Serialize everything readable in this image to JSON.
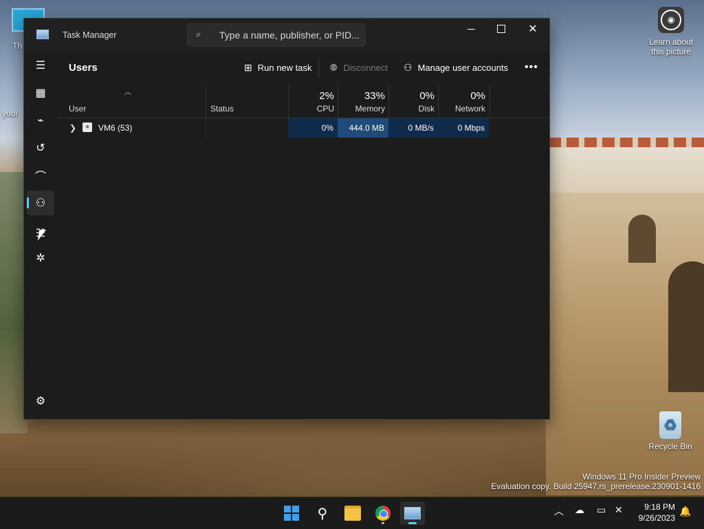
{
  "desktop": {
    "icons": [
      {
        "label": "Learn about this picture"
      },
      {
        "label": "Recycle Bin"
      }
    ],
    "left_fragments": [
      "Th",
      "your"
    ],
    "watermark": {
      "line1": "Windows 11 Pro Insider Preview",
      "line2": "Evaluation copy. Build 25947.rs_prerelease.230901-1416"
    }
  },
  "window": {
    "title": "Task Manager",
    "search_placeholder": "Type a name, publisher, or PID..."
  },
  "nav": {
    "items": [
      {
        "icon": "hamburger-menu-icon"
      },
      {
        "icon": "processes-icon"
      },
      {
        "icon": "performance-icon"
      },
      {
        "icon": "app-history-icon"
      },
      {
        "icon": "startup-apps-icon"
      },
      {
        "icon": "users-icon",
        "active": true
      },
      {
        "icon": "details-icon"
      },
      {
        "icon": "services-icon"
      },
      {
        "icon": "settings-icon"
      }
    ]
  },
  "page": {
    "title": "Users",
    "commands": {
      "run_new_task": "Run new task",
      "disconnect": "Disconnect",
      "manage_user_accounts": "Manage user accounts"
    }
  },
  "table": {
    "columns": {
      "user": "User",
      "status": "Status",
      "cpu": {
        "pct": "2%",
        "label": "CPU"
      },
      "memory": {
        "pct": "33%",
        "label": "Memory"
      },
      "disk": {
        "pct": "0%",
        "label": "Disk"
      },
      "network": {
        "pct": "0%",
        "label": "Network"
      }
    },
    "rows": [
      {
        "user": "VM6 (53)",
        "status": "",
        "cpu": "0%",
        "memory": "444.0 MB",
        "disk": "0 MB/s",
        "network": "0 Mbps"
      }
    ]
  },
  "taskbar": {
    "clock_time": "9:18 PM",
    "clock_date": "9/26/2023"
  }
}
